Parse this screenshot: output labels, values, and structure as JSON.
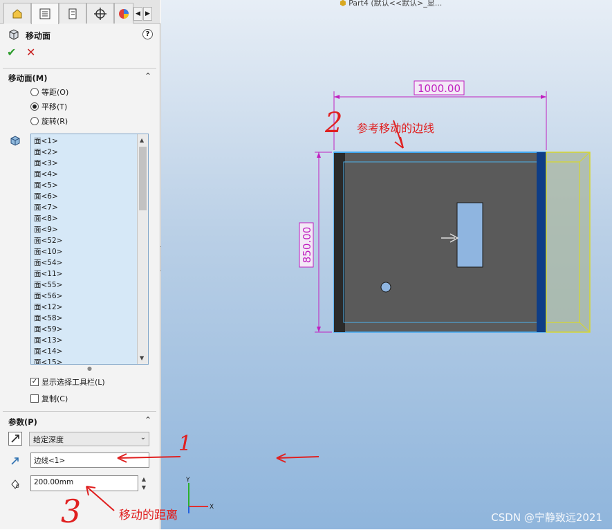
{
  "breadcrumb": "Part4  (默认<<默认>_显...",
  "tabs": [
    "feature-manager",
    "property-manager",
    "configuration-manager",
    "dimxpert-manager",
    "display-manager"
  ],
  "property_manager": {
    "title": "移动面",
    "help": "?",
    "ok": "✔",
    "cancel": "✕"
  },
  "move_face_group": {
    "title": "移动面(M)",
    "options": [
      {
        "label": "等距(O)",
        "selected": false
      },
      {
        "label": "平移(T)",
        "selected": true
      },
      {
        "label": "旋转(R)",
        "selected": false
      }
    ],
    "faces": [
      "面<1>",
      "面<2>",
      "面<3>",
      "面<4>",
      "面<5>",
      "面<6>",
      "面<7>",
      "面<8>",
      "面<9>",
      "面<52>",
      "面<10>",
      "面<54>",
      "面<11>",
      "面<55>",
      "面<56>",
      "面<12>",
      "面<58>",
      "面<59>",
      "面<13>",
      "面<14>",
      "面<15>"
    ],
    "show_toolbar": {
      "label": "显示选择工具栏(L)",
      "checked": true
    },
    "copy": {
      "label": "复制(C)",
      "checked": false
    }
  },
  "params_group": {
    "title": "参数(P)",
    "end_condition": "给定深度",
    "direction_ref": "边线<1>",
    "distance": "200.00mm"
  },
  "model": {
    "dim_width": "1000.00",
    "dim_height": "850.00"
  },
  "annotations": {
    "edge_note": "参考移动的边线",
    "distance_note": "移动的距离",
    "n1": "1",
    "n2": "2",
    "n3": "3"
  },
  "watermark": "CSDN @宁静致远2021",
  "triad": {
    "y": "Y",
    "x": "X"
  },
  "colors": {
    "dimension": "#c020c0",
    "highlight_edge": "#3fa7f0",
    "selected_face": "#e8e84a",
    "annotation": "#e02020"
  }
}
